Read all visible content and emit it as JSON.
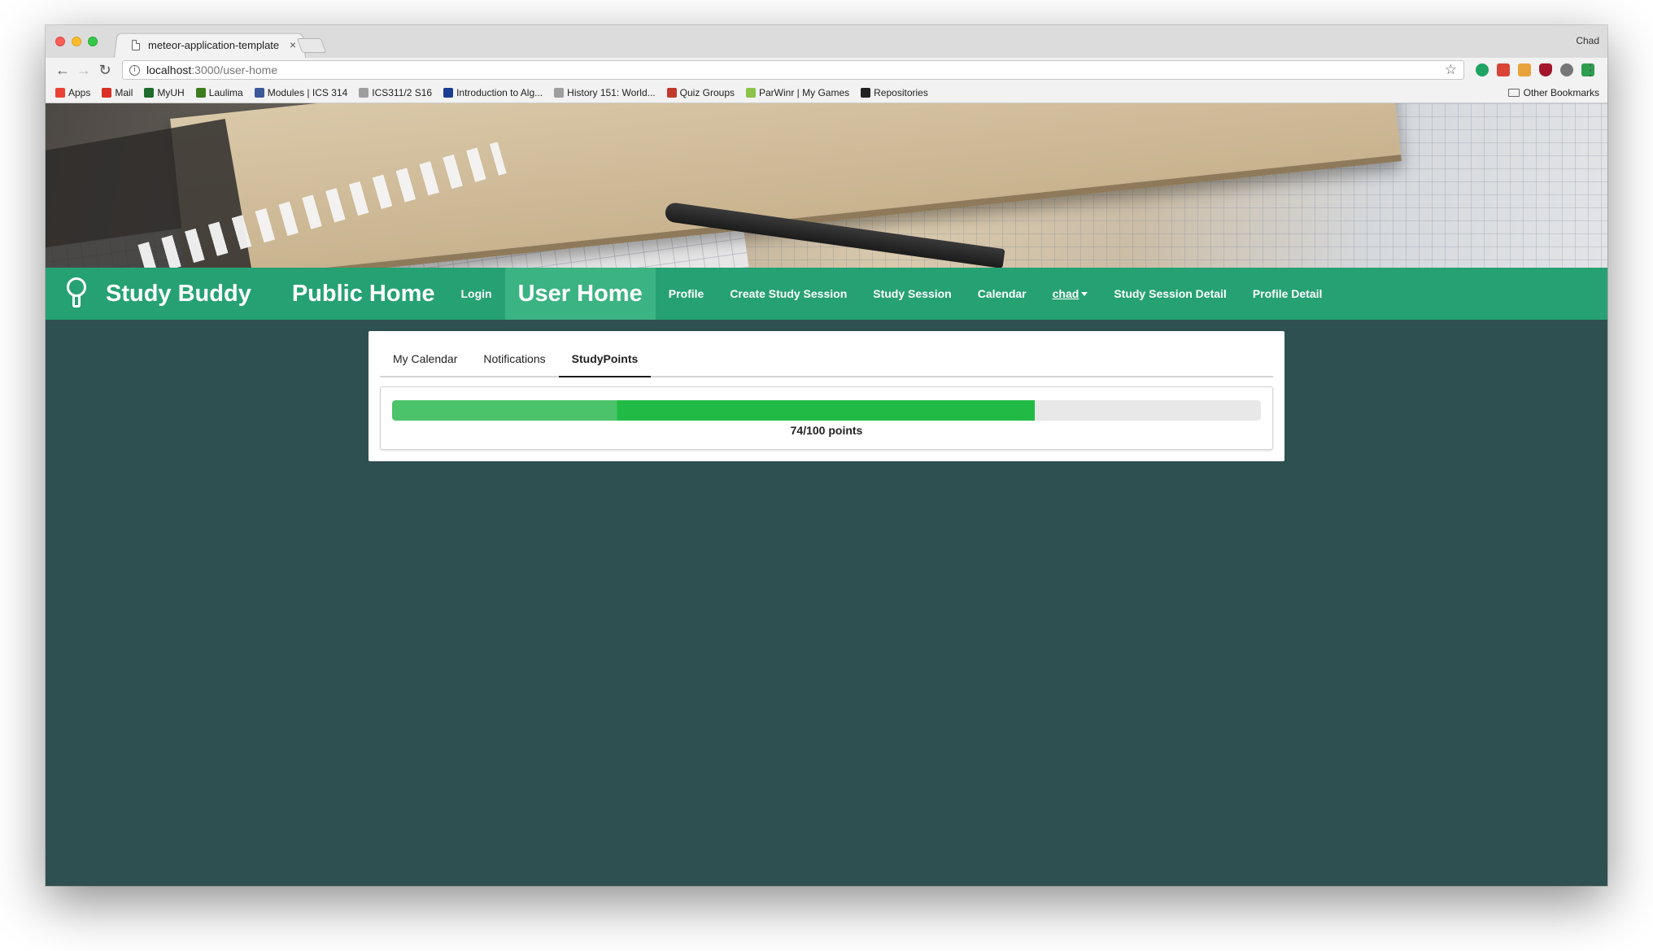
{
  "browser": {
    "tab_title": "meteor-application-template",
    "tab_close": "×",
    "profile_name": "Chad",
    "url_host": "localhost",
    "url_path": ":3000/user-home",
    "back": "←",
    "forward": "→",
    "reload": "↻",
    "info": "i",
    "star": "☆",
    "menu": "⋮",
    "bookmarks": [
      {
        "label": "Apps",
        "color": "#e94235"
      },
      {
        "label": "Mail",
        "color": "#d93025"
      },
      {
        "label": "MyUH",
        "color": "#1e6b2d"
      },
      {
        "label": "Laulima",
        "color": "#3c7d1e"
      },
      {
        "label": "Modules | ICS 314",
        "color": "#3b5998"
      },
      {
        "label": "ICS311/2 S16",
        "color": "#9e9e9e"
      },
      {
        "label": "Introduction to Alg...",
        "color": "#1a3d8f"
      },
      {
        "label": "History 151: World...",
        "color": "#9e9e9e"
      },
      {
        "label": "Quiz Groups",
        "color": "#c0392b"
      },
      {
        "label": "ParWinr | My Games",
        "color": "#8bc34a"
      },
      {
        "label": "Repositories",
        "color": "#222222"
      }
    ],
    "other_bookmarks": "Other Bookmarks"
  },
  "navbar": {
    "brand": "Study Buddy",
    "items": [
      {
        "label": "Public Home",
        "big": true,
        "active": false
      },
      {
        "label": "Login",
        "big": false,
        "active": false
      },
      {
        "label": "User Home",
        "big": true,
        "active": true
      },
      {
        "label": "Profile",
        "big": false,
        "active": false
      },
      {
        "label": "Create Study Session",
        "big": false,
        "active": false
      },
      {
        "label": "Study Session",
        "big": false,
        "active": false
      },
      {
        "label": "Calendar",
        "big": false,
        "active": false
      },
      {
        "label": "chad",
        "big": false,
        "active": false,
        "dropdown": true
      },
      {
        "label": "Study Session Detail",
        "big": false,
        "active": false
      },
      {
        "label": "Profile Detail",
        "big": false,
        "active": false
      }
    ],
    "bg_color": "#26a173",
    "active_color": "#3bb382"
  },
  "card": {
    "tabs": [
      {
        "label": "My Calendar",
        "active": false
      },
      {
        "label": "Notifications",
        "active": false
      },
      {
        "label": "StudyPoints",
        "active": true
      }
    ],
    "progress": {
      "value": 74,
      "max": 100,
      "label": "74/100 points",
      "color": "#21ba45"
    }
  },
  "page": {
    "background_color": "#2f5050"
  }
}
